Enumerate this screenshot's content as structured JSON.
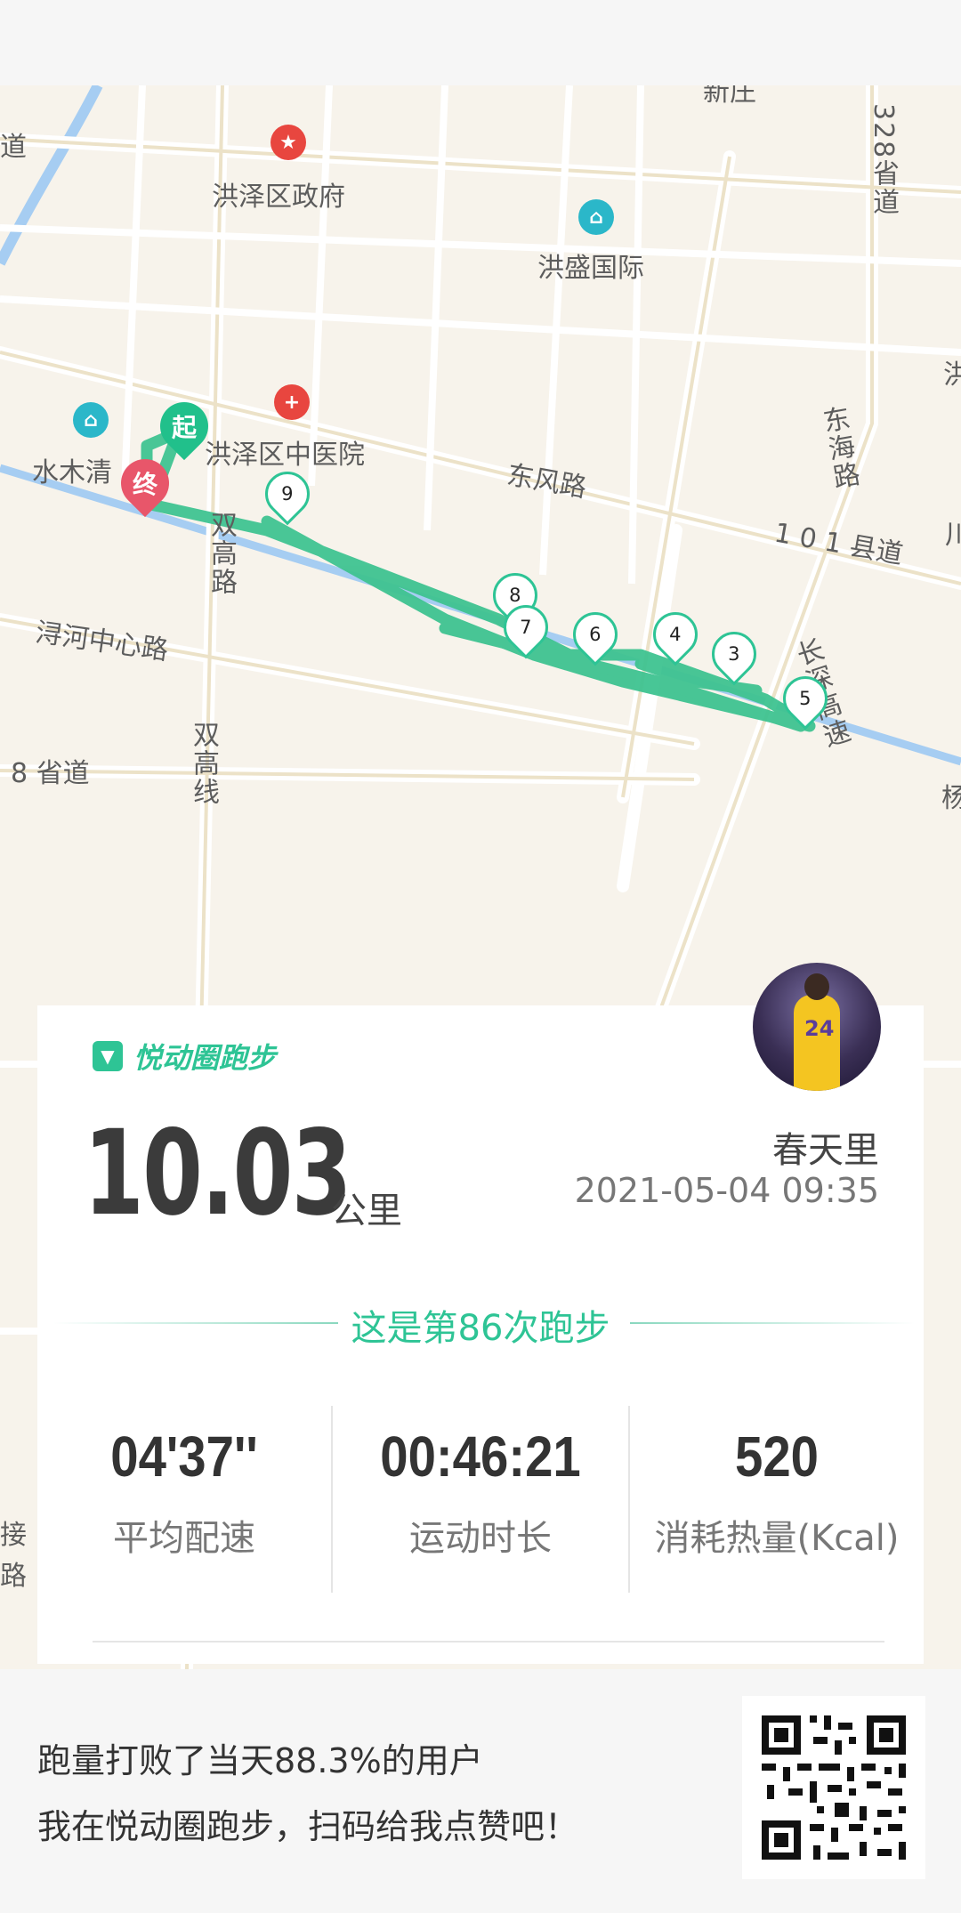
{
  "map": {
    "labels": {
      "gov": "洪泽区政府",
      "hongsheng": "洪盛国际",
      "tcm_hospital": "洪泽区中医院",
      "shuimu": "水木清",
      "dongfeng_road": "东风路",
      "xunhe_road": "浔河中心路",
      "provincial_8": "8 省道",
      "shuanggao_road": "双高路",
      "shuanggao_line": "双高线",
      "donghai_road": "东海路",
      "county_101": "1 0 1 县道",
      "provincial_328": "328省道",
      "changshen": "长深高速",
      "hong_edge": "洪",
      "dao_edge": "道",
      "jie_edge": "接",
      "lu_edge": "路",
      "top_edge": "新庄",
      "chuan_edge": "川",
      "yang_edge": "杨"
    },
    "start_label": "起",
    "end_label": "终",
    "km_markers": [
      "9",
      "8",
      "7",
      "6",
      "4",
      "3",
      "5"
    ]
  },
  "brand": {
    "icon": "yuedong-logo-icon",
    "name": "悦动圈跑步"
  },
  "run": {
    "distance": "10.03",
    "unit": "公里",
    "user": "春天里",
    "datetime": "2021-05-04 09:35",
    "count_text": "这是第86次跑步"
  },
  "stats": [
    {
      "value": "04'37''",
      "label": "平均配速"
    },
    {
      "value": "00:46:21",
      "label": "运动时长"
    },
    {
      "value": "520",
      "label": "消耗热量(Kcal)"
    }
  ],
  "footer": {
    "line1": "跑量打败了当天88.3%的用户",
    "line2": "我在悦动圈跑步，扫码给我点赞吧！"
  },
  "colors": {
    "accent": "#2ec495",
    "route": "#3fc391",
    "start_pin": "#21c08b",
    "end_pin": "#e8566a",
    "river": "#9ec9f3"
  }
}
